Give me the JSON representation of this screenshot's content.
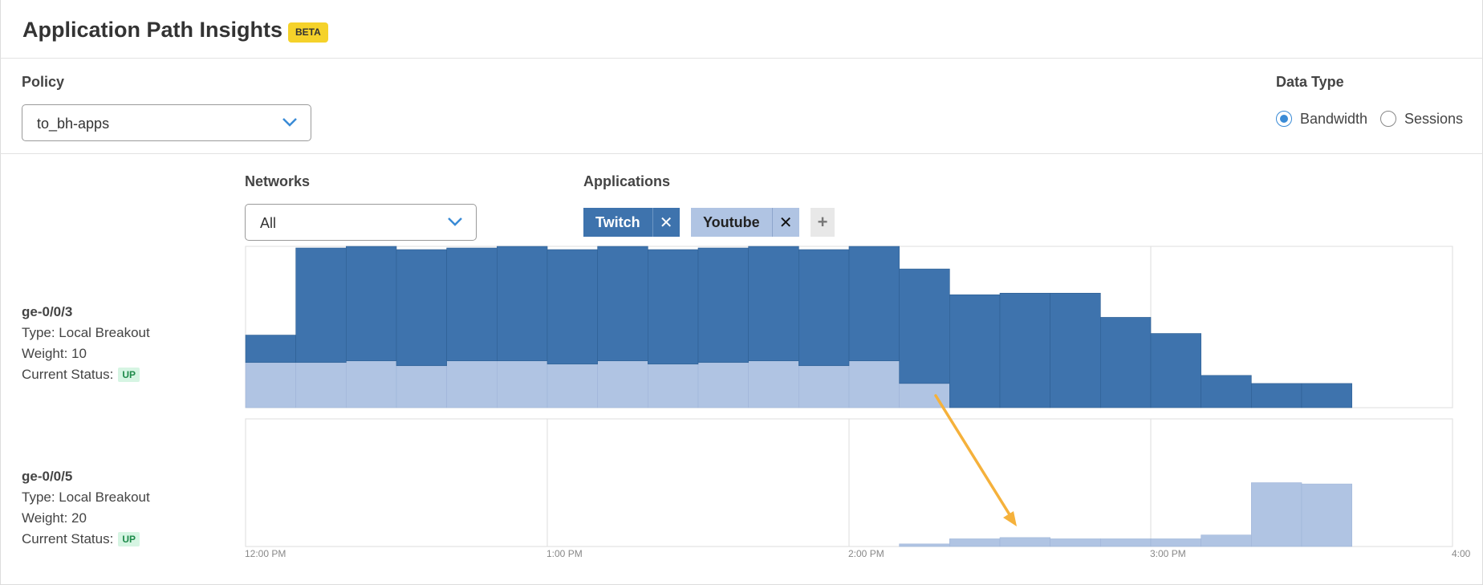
{
  "header": {
    "title": "Application Path Insights",
    "badge": "BETA"
  },
  "policy": {
    "label": "Policy",
    "value": "to_bh-apps"
  },
  "data_type": {
    "label": "Data Type",
    "options": [
      {
        "label": "Bandwidth",
        "selected": true
      },
      {
        "label": "Sessions",
        "selected": false
      }
    ]
  },
  "networks": {
    "label": "Networks",
    "value": "All"
  },
  "applications": {
    "label": "Applications",
    "chips": [
      {
        "label": "Twitch",
        "color": "#3e73ad"
      },
      {
        "label": "Youtube",
        "color": "#b0c4e3"
      }
    ],
    "close_glyph": "✕",
    "add_glyph": "+"
  },
  "interfaces": [
    {
      "name": "ge-0/0/3",
      "type": "Type: Local Breakout",
      "weight": "Weight: 10",
      "status_label": "Current Status:",
      "status": "UP"
    },
    {
      "name": "ge-0/0/5",
      "type": "Type: Local Breakout",
      "weight": "Weight: 20",
      "status_label": "Current Status:",
      "status": "UP"
    }
  ],
  "chart_data": [
    {
      "type": "bar",
      "stacked": true,
      "interface": "ge-0/0/3",
      "x": [
        "12:00",
        "12:10",
        "12:20",
        "12:30",
        "12:40",
        "12:50",
        "1:00",
        "1:10",
        "1:20",
        "1:30",
        "1:40",
        "1:50",
        "2:00",
        "2:10",
        "2:20",
        "2:30",
        "2:40",
        "2:50",
        "3:00",
        "3:10",
        "3:20",
        "3:30"
      ],
      "series": [
        {
          "name": "Youtube",
          "color": "#b0c4e3",
          "values": [
            28,
            28,
            29,
            26,
            29,
            29,
            27,
            29,
            27,
            28,
            29,
            26,
            29,
            15,
            0,
            0,
            0,
            0,
            0,
            0,
            0,
            0
          ]
        },
        {
          "name": "Twitch",
          "color": "#3e73ad",
          "values": [
            17,
            71,
            71,
            72,
            70,
            71,
            71,
            71,
            71,
            71,
            71,
            72,
            71,
            71,
            70,
            71,
            71,
            56,
            46,
            20,
            15,
            15
          ]
        }
      ],
      "ylim": [
        0,
        100
      ],
      "grid_x": true
    },
    {
      "type": "bar",
      "stacked": true,
      "interface": "ge-0/0/5",
      "x": [
        "12:00",
        "12:10",
        "12:20",
        "12:30",
        "12:40",
        "12:50",
        "1:00",
        "1:10",
        "1:20",
        "1:30",
        "1:40",
        "1:50",
        "2:00",
        "2:10",
        "2:20",
        "2:30",
        "2:40",
        "2:50",
        "3:00",
        "3:10",
        "3:20",
        "3:30"
      ],
      "series": [
        {
          "name": "Youtube",
          "color": "#b0c4e3",
          "values": [
            0,
            0,
            0,
            0,
            0,
            0,
            0,
            0,
            0,
            0,
            0,
            0,
            0,
            2,
            6,
            7,
            6,
            6,
            6,
            9,
            50,
            49
          ]
        },
        {
          "name": "Twitch",
          "color": "#3e73ad",
          "values": [
            0,
            0,
            0,
            0,
            0,
            0,
            0,
            0,
            0,
            0,
            0,
            0,
            0,
            0,
            0,
            0,
            0,
            0,
            0,
            0,
            0,
            0
          ]
        }
      ],
      "ylim": [
        0,
        100
      ],
      "grid_x": true
    }
  ],
  "x_ticks": [
    "12:00 PM",
    "1:00 PM",
    "2:00 PM",
    "3:00 PM",
    "4:00"
  ],
  "annotation_color": "#f5b13b"
}
